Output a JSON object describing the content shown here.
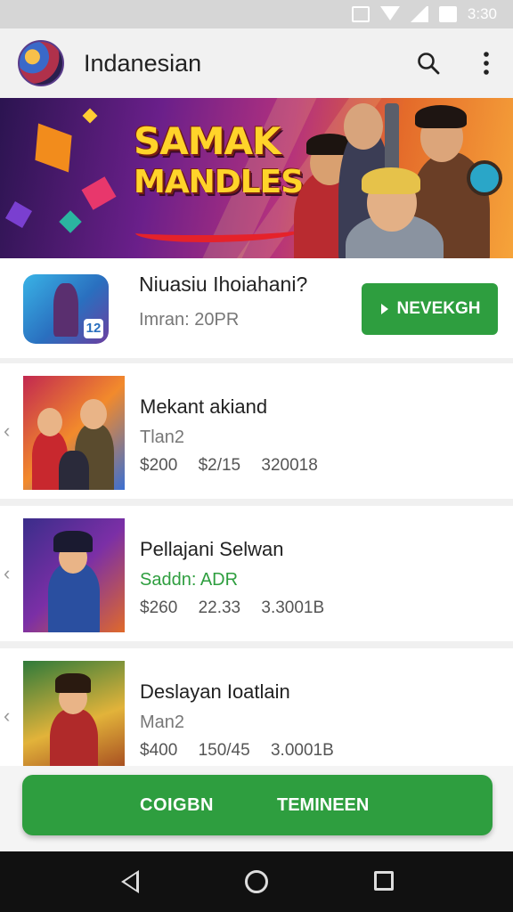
{
  "status_bar": {
    "time": "3:30"
  },
  "app_bar": {
    "title": "Indanesian"
  },
  "banner": {
    "title_line1": "SAMAK",
    "title_line2": "MANDLES"
  },
  "featured": {
    "title": "Niuasiu Ihoiahani?",
    "subtitle": "Imran: 20PR",
    "button_label": "NEVEKGH",
    "button_icon": "play-arrow-icon"
  },
  "cards": [
    {
      "title": "Mekant akiand",
      "subtitle": "Tlan2",
      "subtitle_color": "#777777",
      "prices": [
        "$200",
        "$2/15",
        "320018"
      ]
    },
    {
      "title": "Pellajani Selwan",
      "subtitle": "Saddn: ADR",
      "subtitle_color": "#2e9e3f",
      "prices": [
        "$260",
        "22.33",
        "3.3001B"
      ]
    },
    {
      "title": "Deslayan Ioatlain",
      "subtitle": "Man2",
      "subtitle_color": "#777777",
      "prices": [
        "$400",
        "150/45",
        "3.0001B"
      ]
    }
  ],
  "bottom_button": {
    "left_label": "COIGBN",
    "right_label": "TEMINEEN"
  },
  "colors": {
    "accent_green": "#2e9e3f",
    "app_bar_bg": "#f1f1f1",
    "nav_bar_bg": "#111111"
  },
  "icons": [
    "search-icon",
    "more-vert-icon",
    "chevron-left-icon",
    "back-icon",
    "home-icon",
    "recents-icon"
  ]
}
